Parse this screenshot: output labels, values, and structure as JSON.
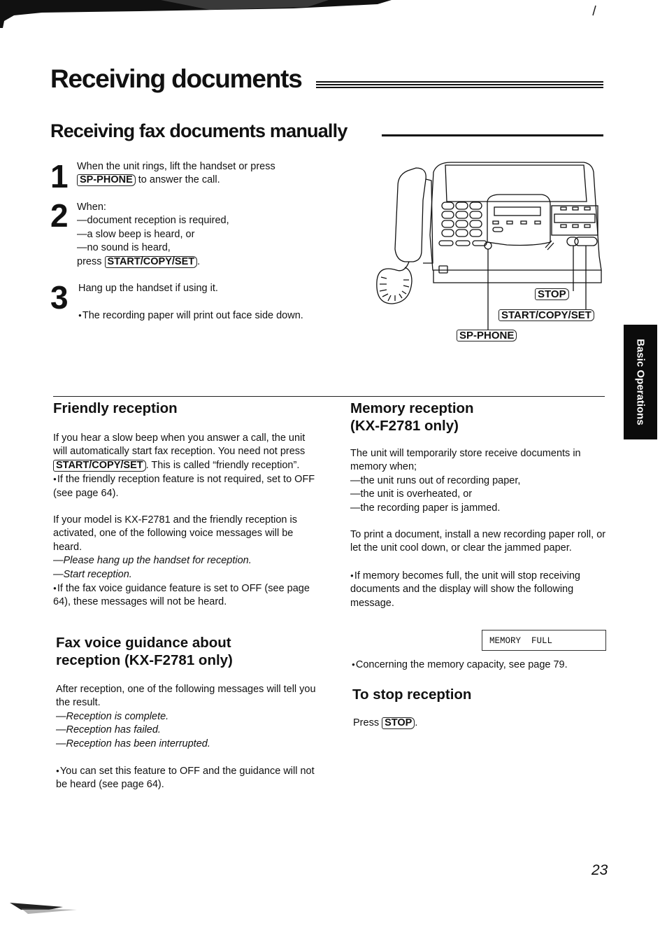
{
  "page": {
    "title": "Receiving documents",
    "subtitle": "Receiving fax documents manually",
    "page_number": "23",
    "side_tab": "Basic Operations",
    "corner_mark": "/"
  },
  "steps": [
    {
      "number": "1",
      "lines": [
        "When the unit rings, lift the handset or press"
      ],
      "key": "SP-PHONE",
      "after_key": " to answer the call."
    },
    {
      "number": "2",
      "intro": "When:",
      "items": [
        "—document reception is required,",
        "—a slow beep is heard, or",
        "—no sound is heard,"
      ],
      "press_prefix": "press ",
      "key": "START/COPY/SET",
      "after_key": "."
    },
    {
      "number": "3",
      "text": "Hang up the handset if using it.",
      "bullet": "The recording paper will print out face side down."
    }
  ],
  "diagram": {
    "labels": {
      "stop": "STOP",
      "start_copy_set": "START/COPY/SET",
      "sp_phone": "SP-PHONE"
    }
  },
  "friendly": {
    "heading": "Friendly reception",
    "p1_a": "If you hear a slow beep when you answer a call, the unit will automatically start fax reception. You need not press ",
    "p1_key": "START/COPY/SET",
    "p1_b": ". This is called “friendly reception”.",
    "bullet1": "If the friendly reception feature is not required, set to OFF (see page 64).",
    "p2": "If your model is KX-F2781 and the friendly reception is activated, one of the following voice messages will be heard.",
    "msgs": [
      "—Please hang up the handset for reception.",
      "—Start reception."
    ],
    "bullet2": "If the fax voice guidance feature is set to OFF (see page 64), these messages will not be heard."
  },
  "guidance": {
    "heading_l1": "Fax voice guidance about",
    "heading_l2": "reception (KX-F2781 only)",
    "p1": "After reception, one of the following messages will tell you the result.",
    "msgs": [
      "—Reception is complete.",
      "—Reception has failed.",
      "—Reception has been interrupted."
    ],
    "bullet": "You can set this feature to OFF and the guidance will not be heard (see page 64)."
  },
  "memory": {
    "heading_l1": "Memory reception",
    "heading_l2": "(KX-F2781 only)",
    "p1": "The unit will temporarily store receive documents in memory when;",
    "items": [
      "—the unit runs out of recording paper,",
      "—the unit is overheated, or",
      "—the recording paper is jammed."
    ],
    "p2": "To print a document, install a new recording paper roll, or let the unit cool down, or clear the jammed paper.",
    "bullet1": "If memory becomes full, the unit will stop receiving documents and the display will show the following message.",
    "display": "MEMORY  FULL",
    "bullet2": "Concerning the memory capacity, see page 79."
  },
  "stop": {
    "heading": "To stop reception",
    "press": "Press ",
    "key": "STOP",
    "after": "."
  }
}
